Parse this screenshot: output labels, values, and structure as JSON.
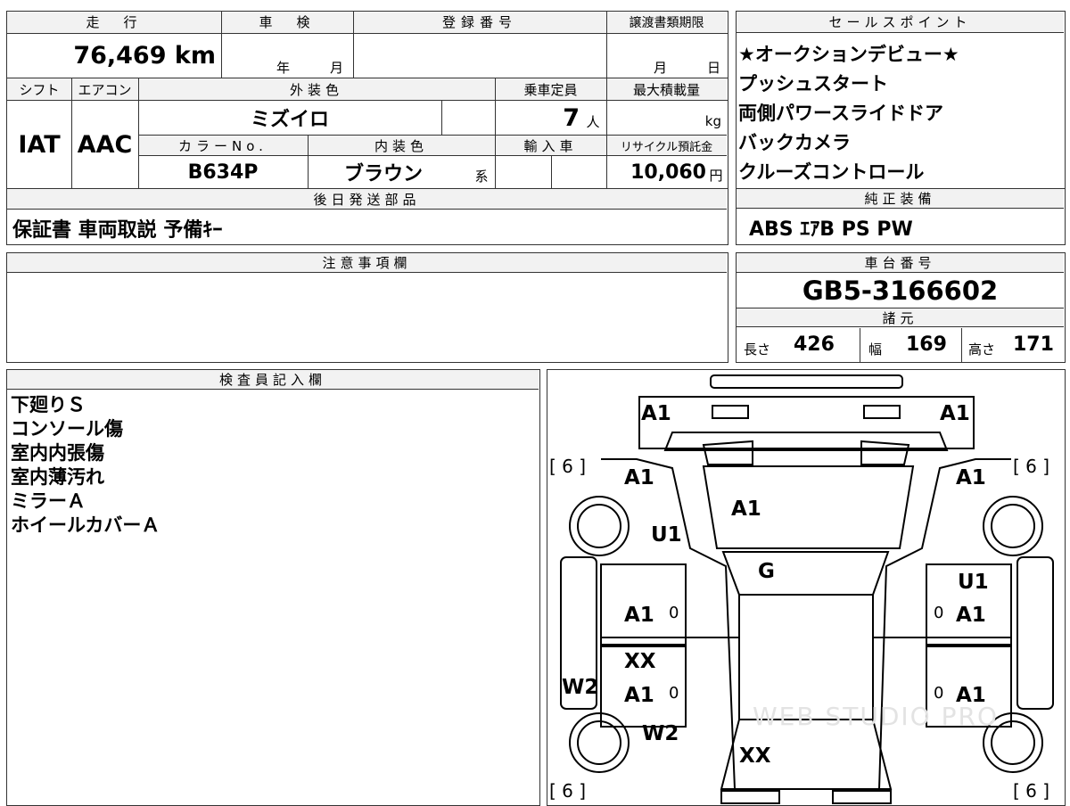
{
  "info": {
    "mileage_header": "走　行",
    "shaken_header": "車　検",
    "reg_header": "登録番号",
    "deadline_header": "譲渡書類期限",
    "mileage": "76,469 km",
    "year_unit": "年",
    "month_unit": "月",
    "deadline_month": "月",
    "deadline_day": "日",
    "shift_header": "シフト",
    "ac_header": "エアコン",
    "ext_color_header": "外装色",
    "capacity_header": "乗車定員",
    "max_load_header": "最大積載量",
    "shift": "IAT",
    "ac": "AAC",
    "ext_color": "ミズイロ",
    "capacity": "7",
    "capacity_unit": "人",
    "max_load_unit": "kg",
    "color_no_header": "カラーNo.",
    "int_color_header": "内装色",
    "import_header": "輸入車",
    "recycle_header": "リサイクル預託金",
    "color_no": "B634P",
    "int_color": "ブラウン",
    "int_color_suffix": "系",
    "recycle": "10,060",
    "recycle_unit": "円",
    "later_parts_header": "後日発送部品",
    "later_parts": "保証書 車両取説 予備ｷｰ"
  },
  "sales": {
    "header": "セールスポイント",
    "points": [
      "★オークションデビュー★",
      "プッシュスタート",
      "両側パワースライドドア",
      "バックカメラ",
      "クルーズコントロール"
    ]
  },
  "equipment": {
    "header": "純正装備",
    "value": "ABS ｴｱB PS PW"
  },
  "notes": {
    "header": "注意事項欄",
    "value": ""
  },
  "chassis": {
    "header": "車台番号",
    "value": "GB5-3166602"
  },
  "specs": {
    "header": "諸元",
    "length_label": "長さ",
    "length": "426",
    "width_label": "幅",
    "width": "169",
    "height_label": "高さ",
    "height": "171"
  },
  "inspector": {
    "header": "検査員記入欄",
    "lines": [
      "下廻りＳ",
      "コンソール傷",
      "室内内張傷",
      "室内薄汚れ",
      "ミラーＡ",
      "ホイールカバーＡ"
    ]
  },
  "diagram": {
    "marks": {
      "front_bumper_left": "A1",
      "front_bumper_right": "A1",
      "front_fender_left": "A1",
      "front_fender_right": "A1",
      "bonnet": "A1",
      "front_wheel_left_area": "U1",
      "windshield": "G",
      "front_door_right_u": "U1",
      "front_door_left": "A1",
      "front_door_right": "A1",
      "rear_door_left_xx": "XX",
      "rear_door_left": "A1",
      "rear_door_right": "A1",
      "side_left": "W2",
      "rear_fender_left": "W2",
      "roof_rear": "XX",
      "door_small_1": "0",
      "door_small_2": "0",
      "door_small_3": "0",
      "door_small_4": "0"
    },
    "tires": [
      "[ 6 ]",
      "[ 6 ]",
      "[ 6 ]",
      "[ 6 ]"
    ],
    "watermark": "WEB STUDIO PRO"
  }
}
